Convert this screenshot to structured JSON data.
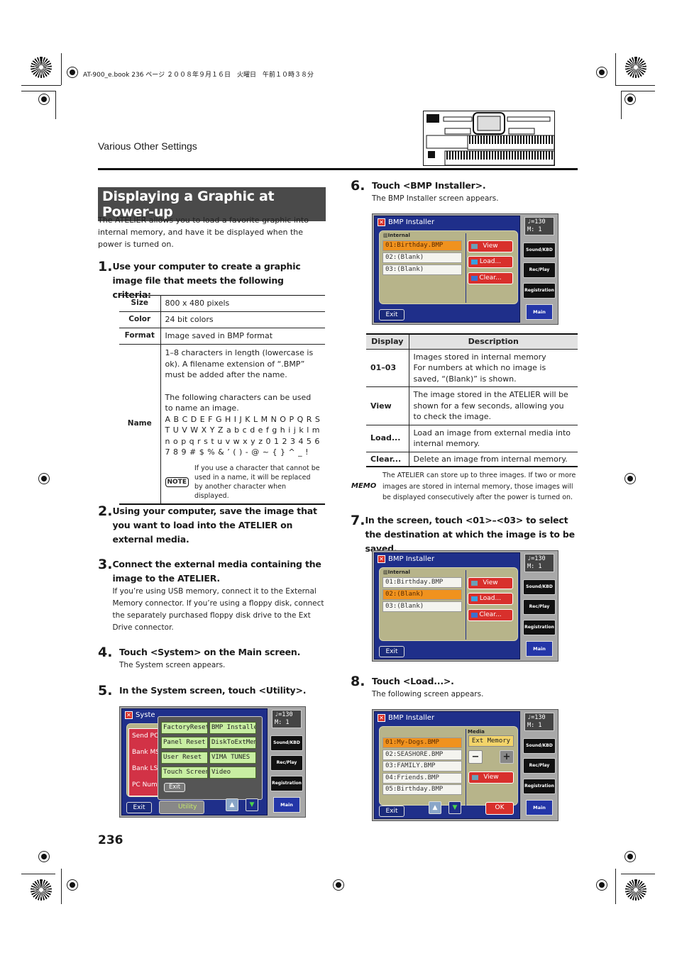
{
  "print_header": "AT-900_e.book  236 ページ  ２００８年９月１６日　火曜日　午前１０時３８分",
  "section": "Various Other Settings",
  "page_number": "236",
  "heading": "Displaying a Graphic at Power-up",
  "intro": "The ATELIER allows you to load a favorite graphic into internal memory, and have it be displayed when the power is turned on.",
  "steps": [
    {
      "num": "1.",
      "title": "Use your computer to create a graphic image file that meets the following criteria:"
    },
    {
      "num": "2.",
      "title": "Using your computer, save the image that you want to load into the ATELIER on external media."
    },
    {
      "num": "3.",
      "title": "Connect the external media containing the image to the ATELIER.",
      "body": "If you’re using USB memory, connect it to the External Memory connector. If you’re using a floppy disk, connect the separately purchased floppy disk drive to the Ext Drive connector."
    },
    {
      "num": "4.",
      "title": "Touch <System> on the Main screen.",
      "body": "The System screen appears."
    },
    {
      "num": "5.",
      "title": "In the System screen, touch <Utility>."
    },
    {
      "num": "6.",
      "title": "Touch <BMP Installer>.",
      "body": "The BMP Installer screen appears."
    },
    {
      "num": "7.",
      "title": "In the screen, touch <01>–<03> to select the destination at which the image is to be saved."
    },
    {
      "num": "8.",
      "title": "Touch <Load...>.",
      "body": "The following screen appears."
    }
  ],
  "criteria": [
    {
      "key": "Size",
      "value": "800 x 480 pixels"
    },
    {
      "key": "Color",
      "value": "24 bit colors"
    },
    {
      "key": "Format",
      "value": "Image saved in BMP format"
    },
    {
      "key": "Name",
      "value1": "1–8 characters in length (lowercase is ok). A filename extension of “.BMP” must be added after the name.",
      "value2": "The following characters can be used to name an image.",
      "chars": "A B C D E F G H I J K L M N O P Q R S T U V W X Y Z a b c d e f g h i j k l m n o p q r s t u v w x y z 0 1 2 3 4 5 6 7 8 9 # $ % & ’ ( ) - @ ~ { } ^ _ !",
      "note_label": "NOTE",
      "note": "If you use a character that cannot be used in a name, it will be replaced by another character when displayed."
    }
  ],
  "desc_table": {
    "headers": [
      "Display",
      "Description"
    ],
    "rows": [
      {
        "key": "01–03",
        "value": "Images stored in internal memory\nFor numbers at which no image is saved, “(Blank)” is shown."
      },
      {
        "key": "View",
        "value": "The image stored in the ATELIER will be shown for a few seconds, allowing you to check the image."
      },
      {
        "key": "Load...",
        "value": "Load an image from external media into internal memory."
      },
      {
        "key": "Clear...",
        "value": "Delete an image from internal memory."
      }
    ]
  },
  "memo": {
    "label": "MEMO",
    "text": "The ATELIER can store up to three images. If two or more images are stored in internal memory, those images will be displayed consecutively after the power is turned on."
  },
  "common_side": {
    "tempo": "♩=130",
    "measure": "M:   1",
    "sound": "Sound/KBD",
    "rec": "Rec/Play",
    "reg": "Registration",
    "main": "Main",
    "exit": "Exit"
  },
  "screen_system": {
    "title": "Syste",
    "left_items": [
      "Send PC",
      "Bank MS",
      "Bank LS",
      "PC Numb"
    ],
    "utility_items": [
      "FactoryReset",
      "BMP Installer",
      "Panel Reset",
      "DiskToExtMem",
      "User Reset",
      "VIMA TUNES",
      "Touch Screen",
      "Video"
    ],
    "popup_exit": "Exit",
    "utility_tab": "Utility"
  },
  "screen_bmp1": {
    "title": "BMP Installer",
    "group": "Internal",
    "items": [
      "01:Birthday.BMP",
      "02:(Blank)",
      "03:(Blank)"
    ],
    "selected": 0,
    "buttons": [
      "View",
      "Load...",
      "Clear..."
    ]
  },
  "screen_bmp2": {
    "title": "BMP Installer",
    "group": "Internal",
    "items": [
      "01:Birthday.BMP",
      "02:(Blank)",
      "03:(Blank)"
    ],
    "selected": 1,
    "buttons": [
      "View",
      "Load...",
      "Clear..."
    ]
  },
  "screen_load": {
    "title": "BMP Installer",
    "media_label": "Media",
    "media_value": "Ext Memory",
    "items": [
      "01:My-Dogs.BMP",
      "02:SEASHORE.BMP",
      "03:FAMILY.BMP",
      "04:Friends.BMP",
      "05:Birthday.BMP"
    ],
    "selected": 0,
    "view": "View",
    "ok": "OK",
    "minus": "−",
    "plus": "+"
  }
}
